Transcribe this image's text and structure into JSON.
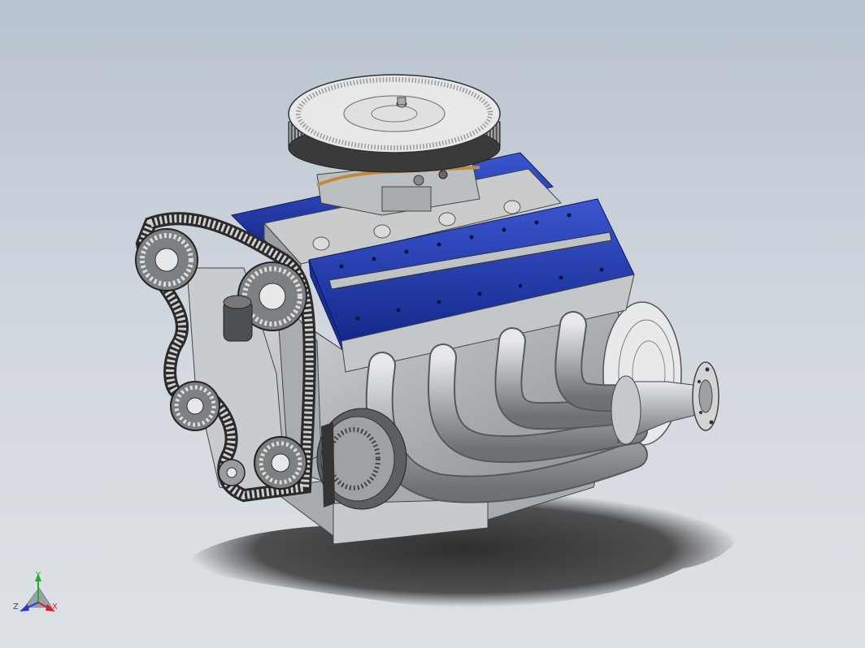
{
  "viewport": {
    "model": "v8-engine-assembly",
    "colors": {
      "background_top": "#b9c3cf",
      "background_bottom": "#dde1e5",
      "valve_cover_blue": "#1f3aa6",
      "metal_gray": "#b8b8b8",
      "dark_gray": "#4a4a4a",
      "brass": "#c08a3e",
      "shadow": "#1a1a1a"
    }
  },
  "triad": {
    "x_label": "X",
    "y_label": "Y",
    "z_label": "Z",
    "x_color": "#d21f1f",
    "y_color": "#1fae2a",
    "z_color": "#1f3ad2"
  }
}
